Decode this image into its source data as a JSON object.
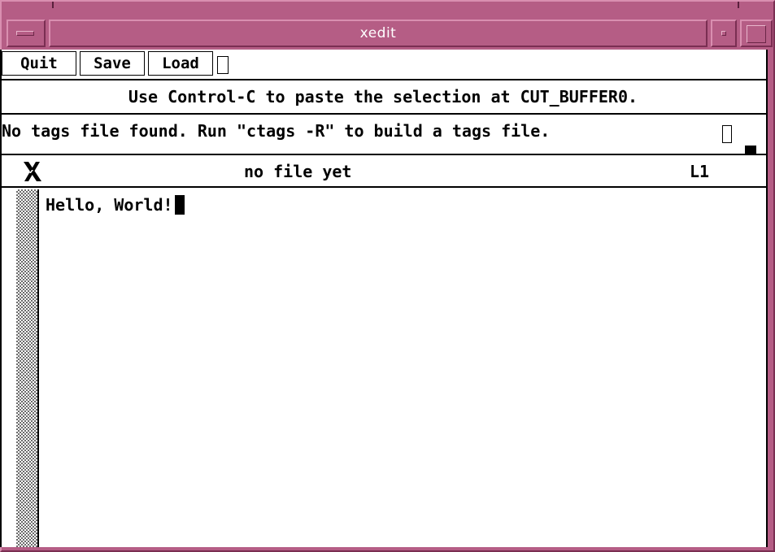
{
  "window": {
    "title": "xedit"
  },
  "buttons": {
    "quit": "Quit",
    "save": "Save",
    "load": "Load"
  },
  "messages": {
    "paste_hint": "Use Control-C to paste the selection at CUT_BUFFER0.",
    "tags_info": "No tags file found. Run \"ctags -R\" to build a tags file."
  },
  "status": {
    "icon": "x-logo-icon",
    "file": "no file yet",
    "line": "L1"
  },
  "editor": {
    "text": "Hello, World!"
  },
  "colors": {
    "frame": "#b55d85",
    "title_text": "#ffffff",
    "background": "#ffffff",
    "text": "#000000"
  }
}
